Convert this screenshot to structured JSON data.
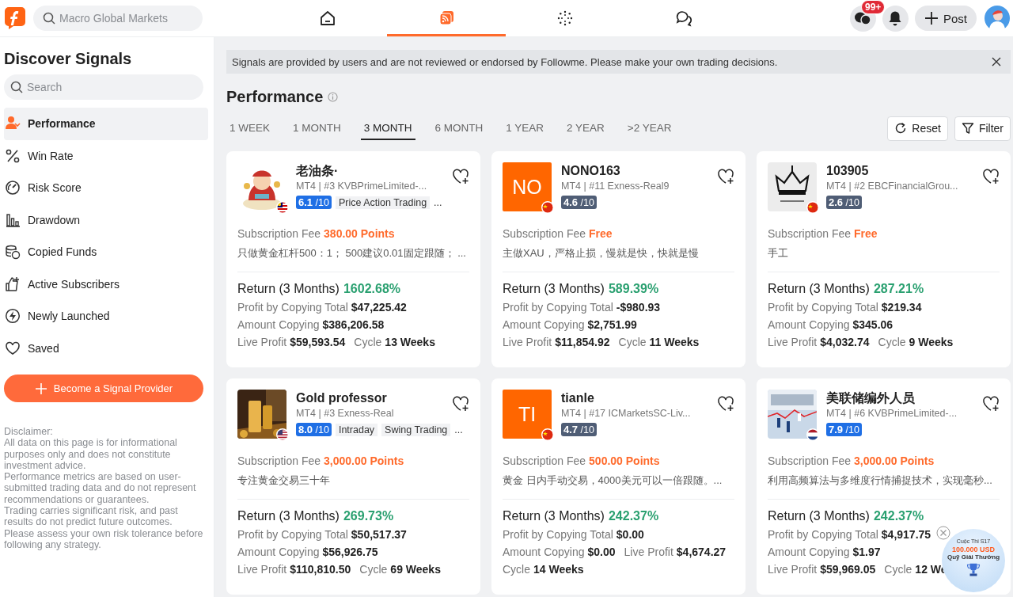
{
  "topbar": {
    "search": {
      "placeholder": "Macro Global Markets"
    },
    "nav": [
      {
        "kind": "home",
        "selected": false
      },
      {
        "kind": "signals",
        "selected": true
      },
      {
        "kind": "explore",
        "selected": false
      },
      {
        "kind": "chat",
        "selected": false
      }
    ],
    "message_badge": "99+",
    "post_button": "Post"
  },
  "sidebar": {
    "title": "Discover Signals",
    "search": {
      "placeholder": "Search"
    },
    "items": [
      {
        "kind": "person",
        "label": "Performance",
        "selected": true
      },
      {
        "kind": "percent",
        "label": "Win Rate",
        "selected": false
      },
      {
        "kind": "gauge",
        "label": "Risk Score",
        "selected": false
      },
      {
        "kind": "bars",
        "label": "Drawdown",
        "selected": false
      },
      {
        "kind": "coins",
        "label": "Copied Funds",
        "selected": false
      },
      {
        "kind": "thumb",
        "label": "Active Subscribers",
        "selected": false
      },
      {
        "kind": "bolt",
        "label": "Newly Launched",
        "selected": false
      },
      {
        "kind": "heart",
        "label": "Saved",
        "selected": false
      }
    ],
    "cta_button": "Become a Signal Provider",
    "disclaimer": [
      "Disclaimer:",
      "All data on this page is for informational purposes only and does not constitute investment advice.",
      "Performance metrics are based on user-submitted trading data and do not represent recommendations or guarantees.",
      "Trading carries significant risk, and past results do not predict future outcomes.",
      "Please assess your own risk tolerance before following any strategy."
    ]
  },
  "notice": "Signals are provided by users and are not reviewed or endorsed by Followme. Please make your own trading decisions.",
  "heading": "Performance",
  "periods": [
    {
      "label": "1 WEEK",
      "selected": false
    },
    {
      "label": "1 MONTH",
      "selected": false
    },
    {
      "label": "3 MONTH",
      "selected": true
    },
    {
      "label": "6 MONTH",
      "selected": false
    },
    {
      "label": "1 YEAR",
      "selected": false
    },
    {
      "label": "2 YEAR",
      "selected": false
    },
    {
      "label": ">2 YEAR",
      "selected": false
    }
  ],
  "reset_button": "Reset",
  "filter_button": "Filter",
  "cards": [
    {
      "name": "老油条·",
      "avatar": {
        "kind": "picture"
      },
      "flag": {
        "kind": "my"
      },
      "account": "MT4 | #3 KVBPrimeLimited-...",
      "score": {
        "value": "6.1",
        "scale": "/10",
        "color": "#1f6fe5"
      },
      "tags": [
        "Price Action Trading"
      ],
      "more": "...",
      "fee_label": "Subscription Fee",
      "fee": "380.00 Points",
      "description": "只做黄金杠杆500：1； 500建议0.01固定跟随； ...",
      "return_label": "Return (3 Months)",
      "return": "1602.68%",
      "stat_lines": [
        [
          {
            "label": "Profit by Copying Total",
            "value": "$47,225.42"
          }
        ],
        [
          {
            "label": "Amount Copying",
            "value": "$386,206.58"
          }
        ],
        [
          {
            "label": "Live Profit",
            "value": "$59,593.54"
          },
          {
            "label": "Cycle",
            "value": "13 Weeks"
          }
        ]
      ]
    },
    {
      "name": "NONO163",
      "avatar": {
        "kind": "initials",
        "initials": "NO"
      },
      "flag": {
        "kind": "cn"
      },
      "account": "MT4 | #11 Exness-Real9",
      "score": {
        "value": "4.6",
        "scale": "/10",
        "color": "#4f5d75"
      },
      "fee_label": "Subscription Fee",
      "fee": "Free",
      "description": "主做XAU，严格止损，慢就是快，快就是慢",
      "return_label": "Return (3 Months)",
      "return": "589.39%",
      "stat_lines": [
        [
          {
            "label": "Profit by Copying Total",
            "value": "-$980.93"
          }
        ],
        [
          {
            "label": "Amount Copying",
            "value": "$2,751.99"
          }
        ],
        [
          {
            "label": "Live Profit",
            "value": "$11,854.92"
          },
          {
            "label": "Cycle",
            "value": "11 Weeks"
          }
        ]
      ]
    },
    {
      "name": "103905",
      "avatar": {
        "kind": "picture"
      },
      "flag": {
        "kind": "cn"
      },
      "account": "MT4 | #2 EBCFinancialGrou...",
      "score": {
        "value": "2.6",
        "scale": "/10",
        "color": "#4f5d75"
      },
      "fee_label": "Subscription Fee",
      "fee": "Free",
      "description": "手工",
      "return_label": "Return (3 Months)",
      "return": "287.21%",
      "stat_lines": [
        [
          {
            "label": "Profit by Copying Total",
            "value": "$219.34"
          }
        ],
        [
          {
            "label": "Amount Copying",
            "value": "$345.06"
          }
        ],
        [
          {
            "label": "Live Profit",
            "value": "$4,032.74"
          },
          {
            "label": "Cycle",
            "value": "9 Weeks"
          }
        ]
      ]
    },
    {
      "name": "Gold professor",
      "avatar": {
        "kind": "picture"
      },
      "flag": {
        "kind": "us"
      },
      "account": "MT4 | #3 Exness-Real",
      "score": {
        "value": "8.0",
        "scale": "/10",
        "color": "#1f6fe5"
      },
      "tags": [
        "Intraday",
        "Swing Trading"
      ],
      "more": "...",
      "fee_label": "Subscription Fee",
      "fee": "3,000.00 Points",
      "description": "专注黄金交易三十年",
      "return_label": "Return (3 Months)",
      "return": "269.73%",
      "stat_lines": [
        [
          {
            "label": "Profit by Copying Total",
            "value": "$50,517.37"
          }
        ],
        [
          {
            "label": "Amount Copying",
            "value": "$56,926.75"
          }
        ],
        [
          {
            "label": "Live Profit",
            "value": "$110,810.50"
          },
          {
            "label": "Cycle",
            "value": "69 Weeks"
          }
        ]
      ]
    },
    {
      "name": "tianle",
      "avatar": {
        "kind": "initials",
        "initials": "TI"
      },
      "flag": {
        "kind": "cn"
      },
      "account": "MT4 | #17 ICMarketsSC-Liv...",
      "score": {
        "value": "4.7",
        "scale": "/10",
        "color": "#4f5d75"
      },
      "fee_label": "Subscription Fee",
      "fee": "500.00 Points",
      "description": "黄金 日内手动交易，4000美元可以一倍跟随。...",
      "return_label": "Return (3 Months)",
      "return": "242.37%",
      "stat_lines": [
        [
          {
            "label": "Profit by Copying Total",
            "value": "$0.00"
          }
        ],
        [
          {
            "label": "Amount Copying",
            "value": "$0.00"
          },
          {
            "label": "Live Profit",
            "value": "$4,674.27"
          }
        ],
        [
          {
            "label": "Cycle",
            "value": "14 Weeks"
          }
        ]
      ]
    },
    {
      "name": "美联储编外人员",
      "avatar": {
        "kind": "picture"
      },
      "flag": {
        "kind": "nl"
      },
      "account": "MT4 | #6 KVBPrimeLimited-...",
      "score": {
        "value": "7.9",
        "scale": "/10",
        "color": "#1f6fe5"
      },
      "fee_label": "Subscription Fee",
      "fee": "3,000.00 Points",
      "description": "利用高频算法与多维度行情捕捉技术，实现毫秒...",
      "return_label": "Return (3 Months)",
      "return": "242.37%",
      "stat_lines": [
        [
          {
            "label": "Profit by Copying Total",
            "value": "$4,917.75"
          }
        ],
        [
          {
            "label": "Amount Copying",
            "value": "$1.97"
          }
        ],
        [
          {
            "label": "Live Profit",
            "value": "$59,969.05"
          },
          {
            "label": "Cycle",
            "value": "12 We"
          }
        ]
      ]
    }
  ],
  "promo": {
    "line_1": "Cuộc Thi S17",
    "line_2": "100.000 USD",
    "line_3": "Quỹ Giải Thưởng"
  }
}
